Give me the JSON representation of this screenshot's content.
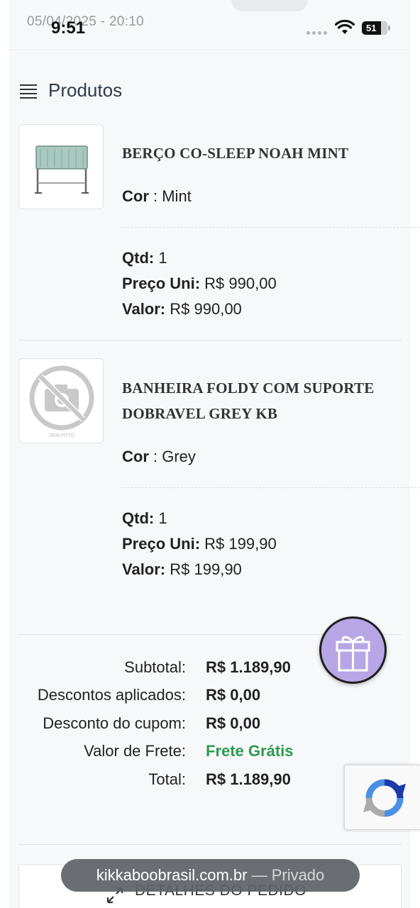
{
  "status_bar": {
    "timestamp": "05/04/2025 - 20:10",
    "time": "9:51",
    "battery": "51"
  },
  "section": {
    "title": "Produtos",
    "icon": "list-icon"
  },
  "products": [
    {
      "name": "BERÇO CO-SLEEP NOAH MINT",
      "color_label": "Cor",
      "color_sep": " : ",
      "color_value": "Mint",
      "qty_label": "Qtd:",
      "qty_value": "1",
      "unit_label": "Preço Uni:",
      "unit_value": "R$ 990,00",
      "total_label": "Valor:",
      "total_value": "R$ 990,00",
      "image": "crib-image"
    },
    {
      "name_line1": "BANHEIRA FOLDY COM SUPORTE",
      "name_line2": "DOBRAVEL GREY KB",
      "color_label": "Cor",
      "color_sep": " : ",
      "color_value": "Grey",
      "qty_label": "Qtd:",
      "qty_value": "1",
      "unit_label": "Preço Uni:",
      "unit_value": "R$ 199,90",
      "total_label": "Valor:",
      "total_value": "R$ 199,90",
      "image_caption": "SEM FOTO"
    }
  ],
  "totals": {
    "subtotal_label": "Subtotal:",
    "subtotal_value": "R$ 1.189,90",
    "discounts_label": "Descontos aplicados:",
    "discounts_value": "R$ 0,00",
    "coupon_label": "Desconto do cupom:",
    "coupon_value": "R$ 0,00",
    "shipping_label": "Valor de Frete:",
    "shipping_value": "Frete Grátis",
    "total_label": "Total:",
    "total_value": "R$ 1.189,90"
  },
  "details": {
    "label": "DETALHES DO PEDIDO"
  },
  "browser": {
    "url": "kikkaboobrasil.com.br",
    "separator": " — ",
    "mode": "Privado"
  },
  "colors": {
    "accent_green": "#2e9b4f",
    "gift_purple": "#b7a6e6",
    "title_color": "#2f3b48"
  }
}
